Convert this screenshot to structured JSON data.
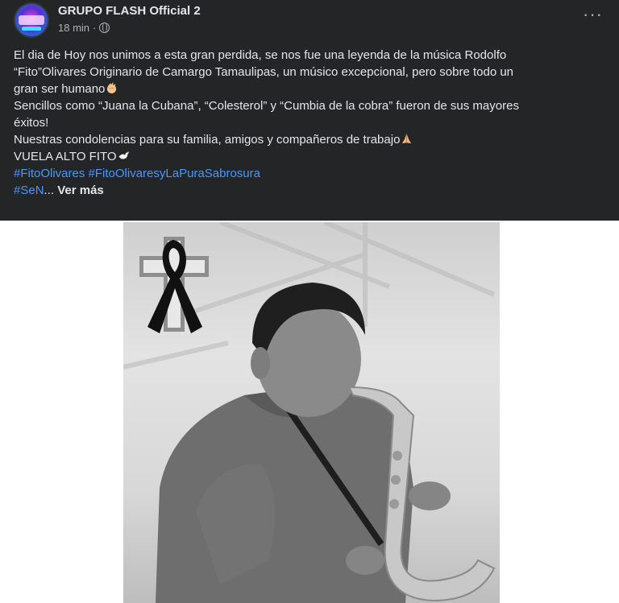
{
  "post": {
    "author": "GRUPO FLASH Official 2",
    "time": "18 min",
    "time_separator": "·",
    "privacy_icon": "globe-icon",
    "options_icon": "more-options-icon",
    "options_label": "···",
    "body_lines": [
      "El dia de Hoy nos unimos a esta gran perdida, se nos fue una leyenda de la música Rodolfo",
      "“Fito”Olivares Originario de Camargo Tamaulipas, un músico excepcional, pero sobre todo un",
      "gran ser humano",
      "Sencillos como “Juana la Cubana”, “Colesterol” y “Cumbia de la cobra” fueron de sus mayores",
      "éxitos!",
      "Nuestras condolencias para su familia, amigos y compañeros de trabajo",
      "VUELA ALTO FITO"
    ],
    "hashtags": [
      "#FitoOlivares",
      "#FitoOlivaresyLaPuraSabrosura"
    ],
    "truncated_hashtag": "#SeN",
    "ellipsis": "...",
    "see_more": "Ver más"
  },
  "image": {
    "alt_subject": "saxophone player with cross and black ribbon"
  },
  "colors": {
    "post_bg": "#242526",
    "text": "#e4e6eb",
    "secondary_text": "#b0b3b8",
    "hashtag": "#4599ff"
  }
}
